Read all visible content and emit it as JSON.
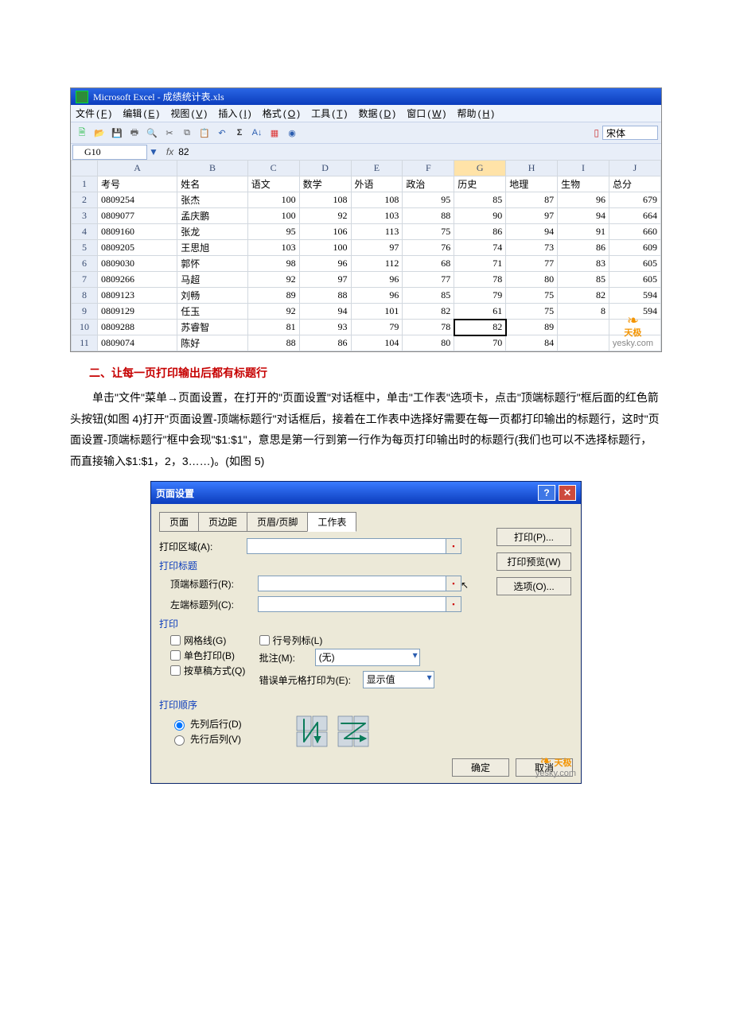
{
  "excel": {
    "app_title": "Microsoft Excel - 成绩统计表.xls",
    "menus": [
      {
        "label": "文件",
        "acc": "F"
      },
      {
        "label": "编辑",
        "acc": "E"
      },
      {
        "label": "视图",
        "acc": "V"
      },
      {
        "label": "插入",
        "acc": "I"
      },
      {
        "label": "格式",
        "acc": "O"
      },
      {
        "label": "工具",
        "acc": "T"
      },
      {
        "label": "数据",
        "acc": "D"
      },
      {
        "label": "窗口",
        "acc": "W"
      },
      {
        "label": "帮助",
        "acc": "H"
      }
    ],
    "toolbar_font": "宋体",
    "namebox": "G10",
    "formula_value": "82",
    "col_headers": [
      "A",
      "B",
      "C",
      "D",
      "E",
      "F",
      "G",
      "H",
      "I",
      "J"
    ],
    "selected_col": "G",
    "header_row": [
      "考号",
      "姓名",
      "语文",
      "数学",
      "外语",
      "政治",
      "历史",
      "地理",
      "生物",
      "总分"
    ],
    "rows": [
      {
        "n": 2,
        "id": "0809254",
        "name": "张杰",
        "c": [
          "100",
          "108",
          "108",
          "95",
          "85",
          "87",
          "96",
          "679"
        ]
      },
      {
        "n": 3,
        "id": "0809077",
        "name": "孟庆鹏",
        "c": [
          "100",
          "92",
          "103",
          "88",
          "90",
          "97",
          "94",
          "664"
        ]
      },
      {
        "n": 4,
        "id": "0809160",
        "name": "张龙",
        "c": [
          "95",
          "106",
          "113",
          "75",
          "86",
          "94",
          "91",
          "660"
        ]
      },
      {
        "n": 5,
        "id": "0809205",
        "name": "王思旭",
        "c": [
          "103",
          "100",
          "97",
          "76",
          "74",
          "73",
          "86",
          "609"
        ]
      },
      {
        "n": 6,
        "id": "0809030",
        "name": "郭怀",
        "c": [
          "98",
          "96",
          "112",
          "68",
          "71",
          "77",
          "83",
          "605"
        ]
      },
      {
        "n": 7,
        "id": "0809266",
        "name": "马超",
        "c": [
          "92",
          "97",
          "96",
          "77",
          "78",
          "80",
          "85",
          "605"
        ]
      },
      {
        "n": 8,
        "id": "0809123",
        "name": "刘畅",
        "c": [
          "89",
          "88",
          "96",
          "85",
          "79",
          "75",
          "82",
          "594"
        ]
      },
      {
        "n": 9,
        "id": "0809129",
        "name": "任玉",
        "c": [
          "92",
          "94",
          "101",
          "82",
          "61",
          "75",
          "8",
          "594"
        ]
      },
      {
        "n": 10,
        "id": "0809288",
        "name": "苏睿智",
        "c": [
          "81",
          "93",
          "79",
          "78",
          "82",
          "89",
          "",
          ""
        ]
      },
      {
        "n": 11,
        "id": "0809074",
        "name": "陈好",
        "c": [
          "88",
          "86",
          "104",
          "80",
          "70",
          "84",
          "",
          ""
        ]
      }
    ],
    "watermark_brand": "天极",
    "watermark_url": "yesky.com"
  },
  "article": {
    "section_title": "二、让每一页打印输出后都有标题行",
    "paragraph": "单击\"文件\"菜单→页面设置，在打开的\"页面设置\"对话框中，单击\"工作表\"选项卡，点击\"顶端标题行\"框后面的红色箭头按钮(如图 4)打开\"页面设置-顶端标题行\"对话框后，接着在工作表中选择好需要在每一页都打印输出的标题行，这时\"页面设置-顶端标题行\"框中会现\"$1:$1\"，意思是第一行到第一行作为每页打印输出时的标题行(我们也可以不选择标题行，而直接输入$1:$1，2，3……)。(如图 5)"
  },
  "dialog": {
    "title": "页面设置",
    "tabs": [
      "页面",
      "页边距",
      "页眉/页脚",
      "工作表"
    ],
    "active_tab": "工作表",
    "print_area_label": "打印区域(A):",
    "print_titles_label": "打印标题",
    "top_rows_label": "顶端标题行(R):",
    "left_cols_label": "左端标题列(C):",
    "print_section_label": "打印",
    "chk_gridlines": "网格线(G)",
    "chk_bw": "单色打印(B)",
    "chk_draft": "按草稿方式(Q)",
    "chk_rowcol": "行号列标(L)",
    "comments_label": "批注(M):",
    "comments_value": "(无)",
    "errors_label": "错误单元格打印为(E):",
    "errors_value": "显示值",
    "order_label": "打印顺序",
    "order_opt1": "先列后行(D)",
    "order_opt2": "先行后列(V)",
    "btn_print": "打印(P)...",
    "btn_preview": "打印预览(W)",
    "btn_options": "选项(O)...",
    "btn_ok": "确定",
    "btn_cancel": "取消",
    "watermark_brand": "天极",
    "watermark_url": "yesky.com"
  }
}
